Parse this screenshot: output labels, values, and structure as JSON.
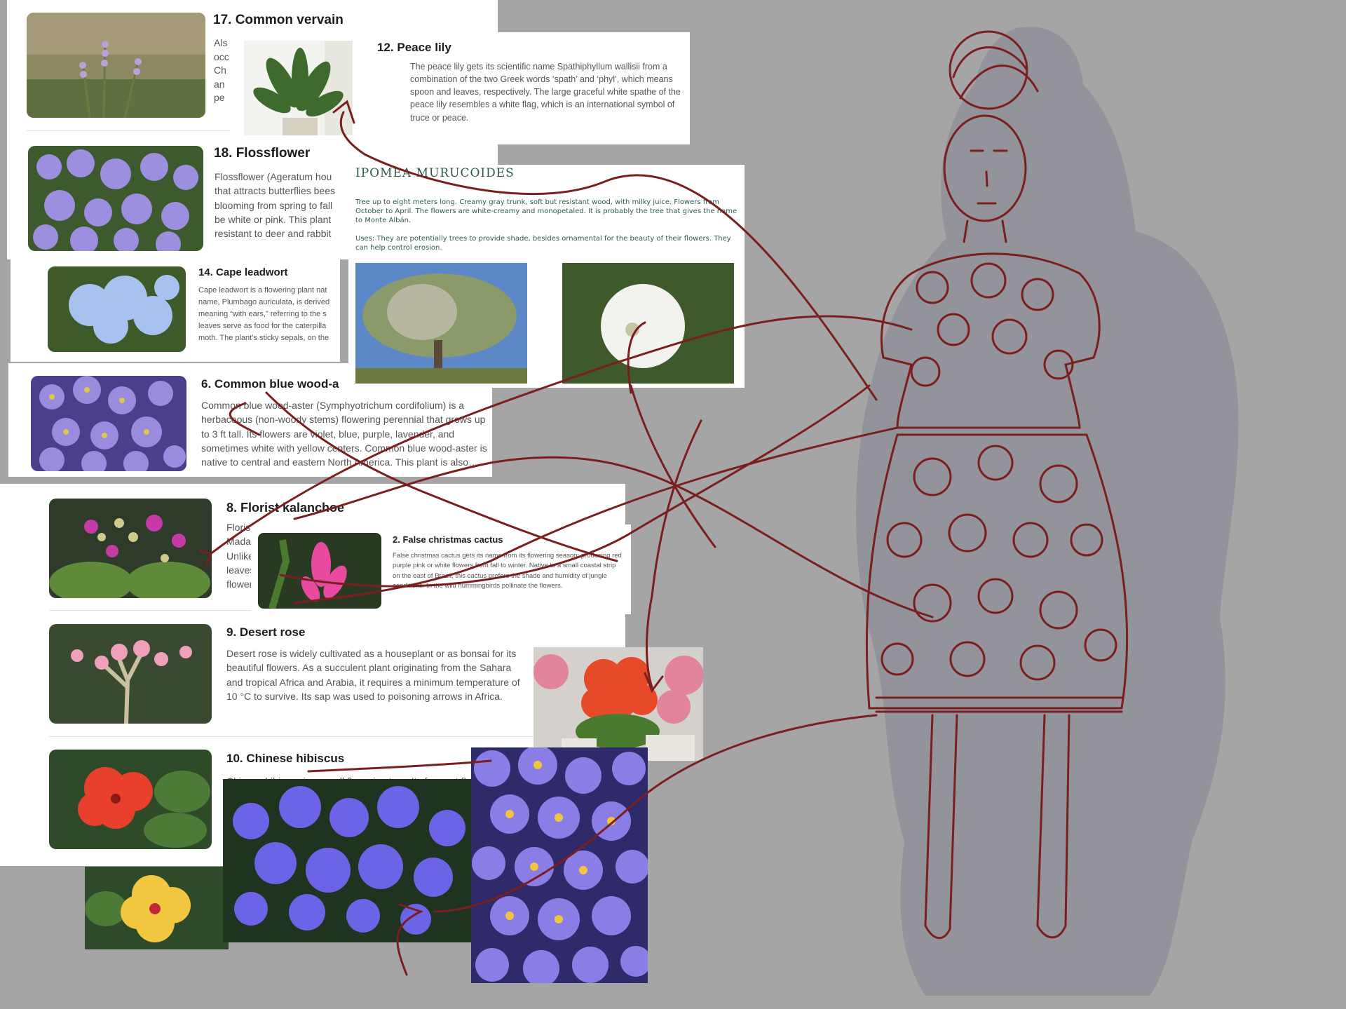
{
  "cards": {
    "vervain": {
      "title": "17. Common vervain",
      "body": "Als\nocc\nCh\nan\npe"
    },
    "peace": {
      "title": "12. Peace lily",
      "body": "The peace lily gets its scientific name Spathiphyllum wallisii from a combination of the two Greek words ‘spath’ and ‘phyl’, which means spoon and leaves, respectively. The large graceful white spathe of the peace lily resembles a white flag, which is an international symbol of truce or peace."
    },
    "floss": {
      "title": "18. Flossflower",
      "body": "Flossflower (Ageratum hou that attracts butterflies bees blooming from spring to fall be white or pink. This plant resistant to deer and rabbit"
    },
    "leadwort": {
      "title": "14. Cape leadwort",
      "body": "Cape leadwort is a flowering plant nat name, Plumbago auriculata, is derived meaning “with ears,” referring to the s leaves serve as food for the caterpilla moth. The plant’s sticky sepals, on the"
    },
    "aster": {
      "title": "6. Common blue wood-a",
      "body": "Common blue wood-aster (Symphyotrichum cordifolium) is a herbaceous (non-woody stems) flowering perennial that grows up to 3 ft tall. Its flowers are violet, blue, purple, lavender, and sometimes white with yellow centers. Common blue wood-aster is native to central and eastern North America. This plant is also…"
    },
    "kalanchoe": {
      "title": "8. Florist kalanchoe",
      "body": "Florist\nMadag\nUnlike\nleaves\nflower"
    },
    "cactus": {
      "title": "2. False christmas cactus",
      "body": "False christmas cactus gets its name from its flowering season; producing red purple pink or white flowers from fall to winter. Native to a small coastal strip on the east of Brazil, this cactus prefers the shade and humidity of jungle conditions. In the wild hummingbirds pollinate the flowers."
    },
    "desert": {
      "title": "9. Desert rose",
      "body": "Desert rose is widely cultivated as a houseplant or as bonsai for its beautiful flowers. As a succulent plant originating from the Sahara and tropical Africa and Arabia, it requires a minimum temperature of 10 °C to survive. Its sap was used to poisoning arrows in Africa."
    },
    "hibiscus": {
      "title": "10. Chinese hibiscus",
      "body": "Chinese hibiscus is a small flowering tree. Its fragrant fl"
    }
  },
  "ipomea": {
    "title": "IPOMEA MURUCOIDES",
    "p1": "Tree up to eight meters long. Creamy gray trunk, soft but resistant wood, with milky juice. Flowers from October to April. The flowers are white-creamy and monopetaled. It is probably the tree that gives the name to Monte Albán.",
    "p2": "Uses: They are potentially trees to provide shade, besides ornamental for the beauty of their flowers. They can help control erosion."
  },
  "colors": {
    "background": "#a5a5a5",
    "sketch": "#7a1f1f",
    "silhouette": "#8e8f99",
    "ipomea_text": "#2f5a50"
  },
  "icons": [
    "figure-sketch",
    "annotation-arrows"
  ]
}
